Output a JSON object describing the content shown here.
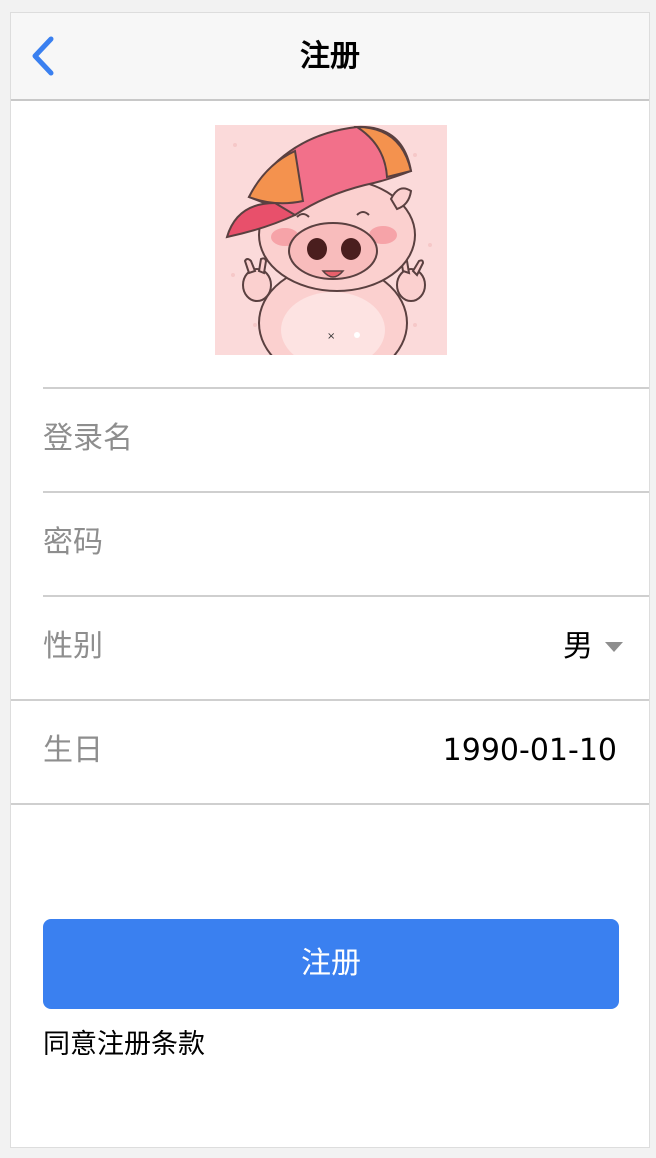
{
  "nav": {
    "title": "注册",
    "back_icon": "chevron-left-icon"
  },
  "colors": {
    "accent": "#3a80f0",
    "label": "#8e8e8e",
    "divider": "#cfcfcf",
    "navbar_bg": "#f7f7f7"
  },
  "avatar": {
    "icon": "pig-avatar-image"
  },
  "form": {
    "username": {
      "placeholder": "登录名",
      "value": ""
    },
    "password": {
      "placeholder": "密码",
      "value": ""
    },
    "gender": {
      "label": "性别",
      "value": "男",
      "icon": "dropdown-caret-icon"
    },
    "birthday": {
      "label": "生日",
      "value": "1990-01-10"
    }
  },
  "submit": {
    "label": "注册"
  },
  "terms": {
    "text": "同意注册条款"
  }
}
